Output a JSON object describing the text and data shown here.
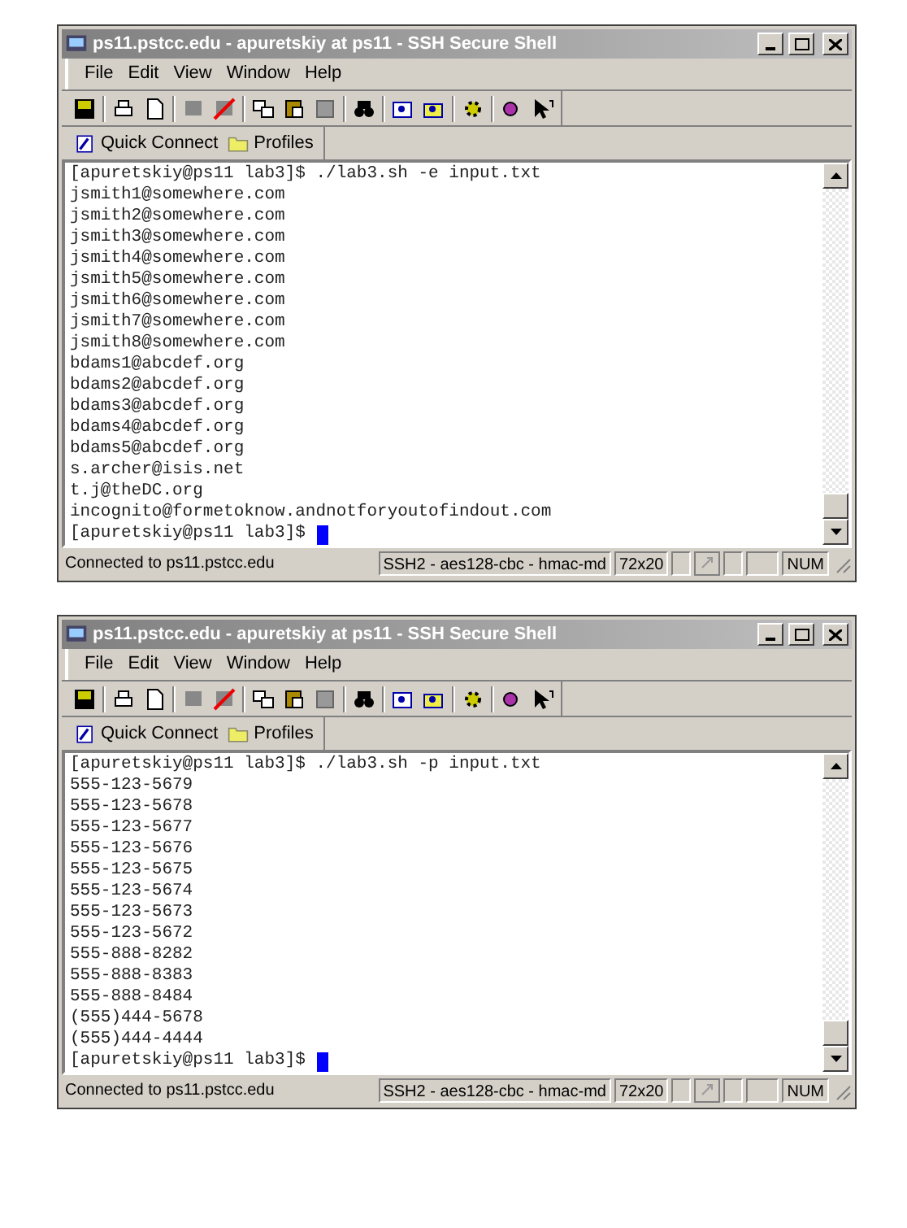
{
  "windows": [
    {
      "title": "ps11.pstcc.edu - apuretskiy at ps11 - SSH Secure Shell",
      "menu": [
        "File",
        "Edit",
        "View",
        "Window",
        "Help"
      ],
      "quick_connect": "Quick Connect",
      "profiles": "Profiles",
      "terminal_lines": [
        "[apuretskiy@ps11 lab3]$ ./lab3.sh -e input.txt",
        "jsmith1@somewhere.com",
        "jsmith2@somewhere.com",
        "jsmith3@somewhere.com",
        "jsmith4@somewhere.com",
        "jsmith5@somewhere.com",
        "jsmith6@somewhere.com",
        "jsmith7@somewhere.com",
        "jsmith8@somewhere.com",
        "bdams1@abcdef.org",
        "bdams2@abcdef.org",
        "bdams3@abcdef.org",
        "bdams4@abcdef.org",
        "bdams5@abcdef.org",
        "s.archer@isis.net",
        "t.j@theDC.org",
        "incognito@formetoknow.andnotforyoutofindout.com",
        "[apuretskiy@ps11 lab3]$"
      ],
      "status": {
        "connection": "Connected to ps11.pstcc.edu",
        "cipher": "SSH2 - aes128-cbc - hmac-md",
        "size": "72x20",
        "num": "NUM"
      }
    },
    {
      "title": "ps11.pstcc.edu - apuretskiy at ps11 - SSH Secure Shell",
      "menu": [
        "File",
        "Edit",
        "View",
        "Window",
        "Help"
      ],
      "quick_connect": "Quick Connect",
      "profiles": "Profiles",
      "terminal_lines": [
        "[apuretskiy@ps11 lab3]$ ./lab3.sh -p input.txt",
        "555-123-5679",
        "555-123-5678",
        "555-123-5677",
        "555-123-5676",
        "555-123-5675",
        "555-123-5674",
        "555-123-5673",
        "555-123-5672",
        "555-888-8282",
        "555-888-8383",
        "555-888-8484",
        "(555)444-5678",
        "(555)444-4444",
        "[apuretskiy@ps11 lab3]$"
      ],
      "status": {
        "connection": "Connected to ps11.pstcc.edu",
        "cipher": "SSH2 - aes128-cbc - hmac-md",
        "size": "72x20",
        "num": "NUM"
      }
    }
  ]
}
